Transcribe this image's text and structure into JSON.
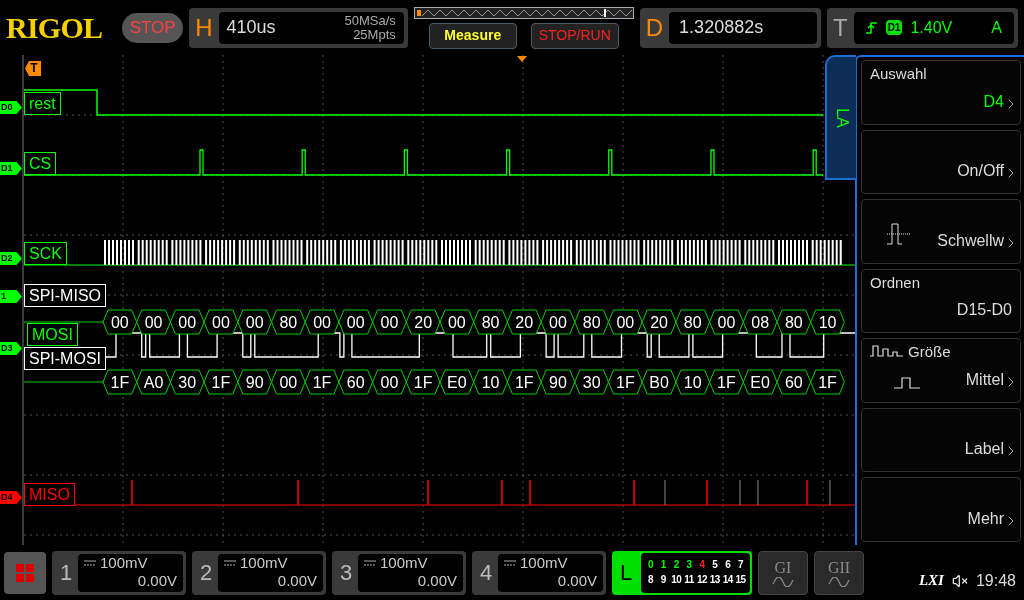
{
  "header": {
    "brand": "RIGOL",
    "run_state": "STOP",
    "horizontal": {
      "key": "H",
      "timebase": "410us",
      "sample_rate": "50MSa/s",
      "memory_depth": "25Mpts"
    },
    "measure_button": "Measure",
    "stop_run_button": "STOP/RUN",
    "delay": {
      "key": "D",
      "value": "1.320882s"
    },
    "trigger": {
      "key": "T",
      "source": "D1",
      "level": "1.40V",
      "mode": "A"
    }
  },
  "trigger_marker": "T",
  "digital_channels": [
    {
      "tag": "D0",
      "label": "rest",
      "kind": "step",
      "color": "#00ff00"
    },
    {
      "tag": "D1",
      "label": "CS",
      "kind": "pulses",
      "color": "#00ff00"
    },
    {
      "tag": "D2",
      "label": "SCK",
      "kind": "clock",
      "color": "#00ff00"
    },
    {
      "tag": "D3",
      "label": "MOSI",
      "kind": "data",
      "color": "#00ff00"
    },
    {
      "tag": "D4",
      "label": "MISO",
      "kind": "spikes",
      "color": "#ff0000"
    }
  ],
  "buses": [
    {
      "tag": "1",
      "label": "SPI-MISO",
      "packets": [
        "00",
        "00",
        "00",
        "00",
        "00",
        "80",
        "00",
        "00",
        "00",
        "20",
        "00",
        "80",
        "20",
        "00",
        "80",
        "00",
        "20",
        "80",
        "00",
        "08",
        "80",
        "10"
      ]
    },
    {
      "label": "SPI-MOSI",
      "packets": [
        "1F",
        "A0",
        "30",
        "1F",
        "90",
        "00",
        "1F",
        "60",
        "00",
        "1F",
        "E0",
        "10",
        "1F",
        "90",
        "30",
        "1F",
        "B0",
        "10",
        "1F",
        "E0",
        "60",
        "1F"
      ]
    }
  ],
  "la_tab": "LA",
  "menu": [
    {
      "kind": "plain",
      "title": "Auswahl",
      "value": "D4",
      "highlight": true,
      "submenu": true
    },
    {
      "kind": "plain",
      "value": "On/Off",
      "highlight": false,
      "submenu": true
    },
    {
      "kind": "threshold",
      "value": "Schwellw",
      "highlight": false,
      "submenu": true
    },
    {
      "kind": "plain",
      "title": "Ordnen",
      "value": "D15-D0",
      "highlight": false,
      "submenu": false
    },
    {
      "kind": "size",
      "title": "Größe",
      "value": "Mittel",
      "highlight": false,
      "submenu": true
    },
    {
      "kind": "plain",
      "value": "Label",
      "highlight": false,
      "submenu": true
    },
    {
      "kind": "plain",
      "value": "Mehr",
      "highlight": false,
      "submenu": true
    }
  ],
  "bottom": {
    "channels": [
      {
        "number": "1",
        "scale": "100mV",
        "offset": "0.00V"
      },
      {
        "number": "2",
        "scale": "100mV",
        "offset": "0.00V"
      },
      {
        "number": "3",
        "scale": "100mV",
        "offset": "0.00V"
      },
      {
        "number": "4",
        "scale": "100mV",
        "offset": "0.00V"
      }
    ],
    "logic": {
      "key": "L",
      "bits": [
        {
          "label": "0",
          "color": "#00ff00"
        },
        {
          "label": "1",
          "color": "#00ff00"
        },
        {
          "label": "2",
          "color": "#00ff00"
        },
        {
          "label": "3",
          "color": "#00ff00"
        },
        {
          "label": "4",
          "color": "#ff2020"
        },
        {
          "label": "5",
          "color": "#ffffff"
        },
        {
          "label": "6",
          "color": "#ffffff"
        },
        {
          "label": "7",
          "color": "#ffffff"
        },
        {
          "label": "8",
          "color": "#ffffff"
        },
        {
          "label": "9",
          "color": "#ffffff"
        },
        {
          "label": "10",
          "color": "#ffffff"
        },
        {
          "label": "11",
          "color": "#ffffff"
        },
        {
          "label": "12",
          "color": "#ffffff"
        },
        {
          "label": "13",
          "color": "#ffffff"
        },
        {
          "label": "14",
          "color": "#ffffff"
        },
        {
          "label": "15",
          "color": "#ffffff"
        }
      ]
    },
    "generators": [
      "GI",
      "GII"
    ],
    "lxi": "LXI",
    "time": "19:48"
  }
}
